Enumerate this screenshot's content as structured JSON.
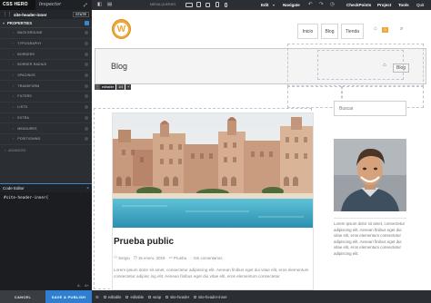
{
  "left_panel": {
    "tabs": {
      "css_hero": "CSS HERO",
      "inspector": "Inspector",
      "expand_icon": "expand-icon"
    },
    "selector": {
      "label": "site-header-inner",
      "state": "STATE"
    },
    "properties_title": "PROPERTIES",
    "properties": [
      "BACKGROUND",
      "TYPOGRAPHY",
      "BORDERS",
      "BORDER RADIUS",
      "SPACINGS",
      "TRANSFORM",
      "FILTERS",
      "LISTS",
      "EXTRA",
      "MEASURES",
      "POSITIONING"
    ],
    "advanced": "ADVANCED",
    "code_editor": {
      "title": "Code Editor",
      "code": "#site-header-inner{"
    },
    "buttons": {
      "cancel": "CANCEL",
      "save": "SAVE & PUBLISH"
    }
  },
  "toolbar": {
    "media_queries": "MEDIA QUERIES",
    "edit": "Edit",
    "navigate": "Navigate",
    "checkpoints": "CheckPoints",
    "project": "Project",
    "tools": "Tools",
    "quit": "Quit"
  },
  "site": {
    "logo_letter": "W",
    "nav": [
      "Inicio",
      "Blog",
      "Tienda"
    ],
    "cart_count": "0",
    "page_title": "Blog",
    "breadcrumb": "Blog",
    "edit_badge": {
      "editable": "editable",
      "b1": "1/4",
      "b2": "+"
    },
    "post": {
      "title": "Prueba public",
      "author": "Sergio",
      "date": "16 enero, 2019",
      "category": "Prueba",
      "comments": "Sin comentarios",
      "excerpt": "Lorem ipsum dolor sit amet, consectetur adipiscing elit. Aenean finibus eget dui vitae elit, eros elementum consectetur adipisc ing elit. Aenean finibus eget dui vitae elit, eros elementum consectetur"
    },
    "sidebar": {
      "search_placeholder": "Buscar",
      "text": "Lorem ipsum dolor sit amet, consectetur adipiscing elit. Aenean finibus eget dui vitae elit, eros elementum consectetur adipiscing elit. Aenean finibus eget dui vitae elit, eros elementum consectetur adipiscing elit."
    }
  },
  "statusbar": {
    "items": [
      "editable",
      "editable",
      "wrap",
      "site-header",
      "site-header-inner"
    ]
  },
  "colors": {
    "accent_blue": "#2f7fd1",
    "logo_orange": "#f0a73a",
    "panel_dark": "#2b2e33"
  }
}
